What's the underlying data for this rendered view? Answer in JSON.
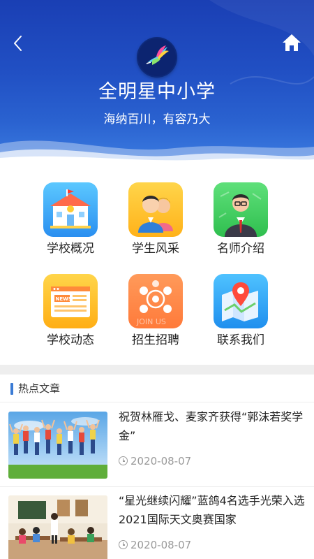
{
  "header": {
    "school_name": "全明星中小学",
    "motto": "海纳百川，有容乃大",
    "back_icon": "chevron-left-icon",
    "home_icon": "home-icon",
    "logo_icon": "hummingbird-logo"
  },
  "menu": {
    "items": [
      {
        "label": "学校概况",
        "icon": "school-building-icon"
      },
      {
        "label": "学生风采",
        "icon": "students-icon"
      },
      {
        "label": "名师介绍",
        "icon": "teacher-icon"
      },
      {
        "label": "学校动态",
        "icon": "news-icon"
      },
      {
        "label": "招生招聘",
        "icon": "recruitment-icon"
      },
      {
        "label": "联系我们",
        "icon": "map-location-icon"
      }
    ]
  },
  "hot_articles": {
    "title": "热点文章",
    "items": [
      {
        "title": "祝贺林雁戈、麦家齐获得“郭沫若奖学金”",
        "date": "2020-08-07"
      },
      {
        "title": "“星光继续闪耀”蓝鸽4名选手光荣入选2021国际天文奥赛国家",
        "date": "2020-08-07"
      }
    ]
  },
  "colors": {
    "header_blue": "#1a3fb4",
    "accent_blue": "#3a7bd5",
    "date_gray": "#9a9a9a"
  }
}
